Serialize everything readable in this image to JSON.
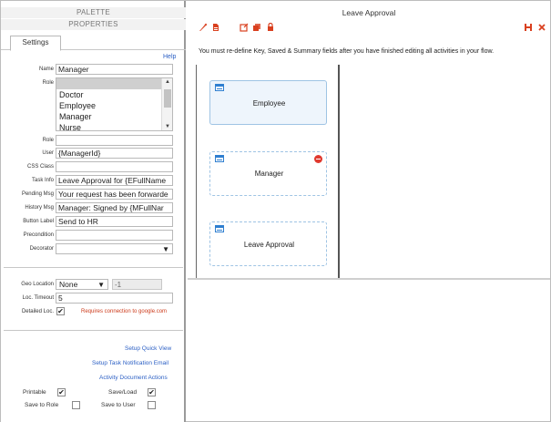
{
  "palette": {
    "title": "PALETTE"
  },
  "properties": {
    "title": "PROPERTIES"
  },
  "tabs": {
    "settings": "Settings"
  },
  "help": "Help",
  "fields": {
    "name_label": "Name",
    "name_value": "Manager",
    "role_label": "Role",
    "role_options": [
      "",
      "Doctor",
      "Employee",
      "Manager",
      "Nurse"
    ],
    "role2_label": "Role",
    "role2_value": "",
    "user_label": "User",
    "user_value": "{ManagerId}",
    "css_label": "CSS Class",
    "css_value": "",
    "task_label": "Task Info",
    "task_value": "Leave Approval for {EFullName",
    "pending_label": "Pending Msg",
    "pending_value": "Your request has been forwarde",
    "history_label": "History Msg",
    "history_value": "Manager: Signed by {MFullNar",
    "button_label": "Button Label",
    "button_value": "Send to HR",
    "precondition_label": "Precondition",
    "precondition_value": "",
    "decorator_label": "Decorator",
    "decorator_value": ""
  },
  "geo": {
    "label": "Geo Location",
    "value": "None",
    "extra_value": "-1",
    "timeout_label": "Loc. Timeout",
    "timeout_value": "5",
    "detailed_label": "Detailed Loc.",
    "detailed_checked": true,
    "warning": "Requires connection to google.com"
  },
  "links": {
    "quick_view": "Setup Quick View",
    "notification": "Setup Task Notification Email",
    "document_actions": "Activity Document Actions"
  },
  "options": {
    "printable_label": "Printable",
    "printable_checked": true,
    "saveload_label": "Save/Load",
    "saveload_checked": true,
    "save_role_label": "Save to Role",
    "save_role_checked": false,
    "save_user_label": "Save to User",
    "save_user_checked": false
  },
  "flow": {
    "title": "Leave Approval",
    "notice": "You must re-define Key, Saved & Summary fields after you have finished editing all activities in your flow.",
    "nodes": [
      {
        "label": "Employee"
      },
      {
        "label": "Manager"
      },
      {
        "label": "Leave Approval"
      }
    ]
  },
  "icons": {
    "edit": "pencil-icon",
    "document": "document-icon",
    "external": "external-edit-icon",
    "copy": "copy-icon",
    "lock": "lock-icon",
    "save": "save-icon",
    "close": "close-icon"
  },
  "colors": {
    "accent_red": "#e03a2f",
    "link_blue": "#2b5fc4",
    "node_border": "#9fc4e4",
    "warning_red": "#cc3a1a"
  }
}
